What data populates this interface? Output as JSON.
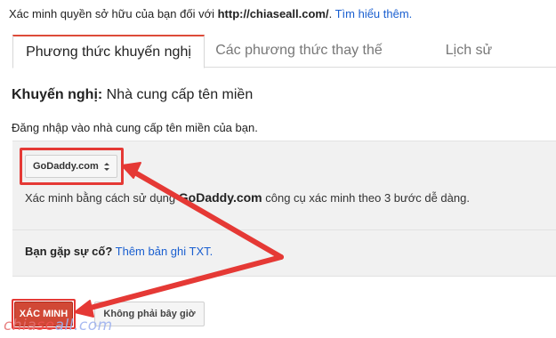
{
  "intro": {
    "text_before": "Xác minh quyền sở hữu của bạn đối với ",
    "site": "http://chiaseall.com/",
    "text_after": ". ",
    "learn_more": "Tìm hiểu thêm."
  },
  "tabs": [
    {
      "label": "Phương thức khuyến nghị",
      "active": true
    },
    {
      "label": "Các phương thức thay thế",
      "active": false
    },
    {
      "label": "Lịch sử",
      "active": false
    }
  ],
  "section": {
    "heading_bold": "Khuyến nghị:",
    "heading_rest": " Nhà cung cấp tên miền",
    "subtext": "Đăng nhập vào nhà cung cấp tên miền của bạn."
  },
  "provider_select": {
    "selected": "GoDaddy.com",
    "icon": "chevron-updown-icon"
  },
  "description": {
    "before": "Xác minh bằng cách sử dụng ",
    "brand": "GoDaddy.com",
    "after": " công cụ xác minh theo 3 bước dễ dàng."
  },
  "trouble": {
    "question": "Bạn gặp sự cố?",
    "link": "Thêm bản ghi TXT."
  },
  "buttons": {
    "verify": "XÁC MINH",
    "not_now": "Không phải bây giờ"
  },
  "watermark": {
    "part1": "chia",
    "part2": "se",
    "part3": "all.com"
  },
  "colors": {
    "accent_red": "#dd4b39",
    "annotation_red": "#e53935",
    "link_blue": "#1a5fd0",
    "panel_bg": "#f1f1f1"
  }
}
